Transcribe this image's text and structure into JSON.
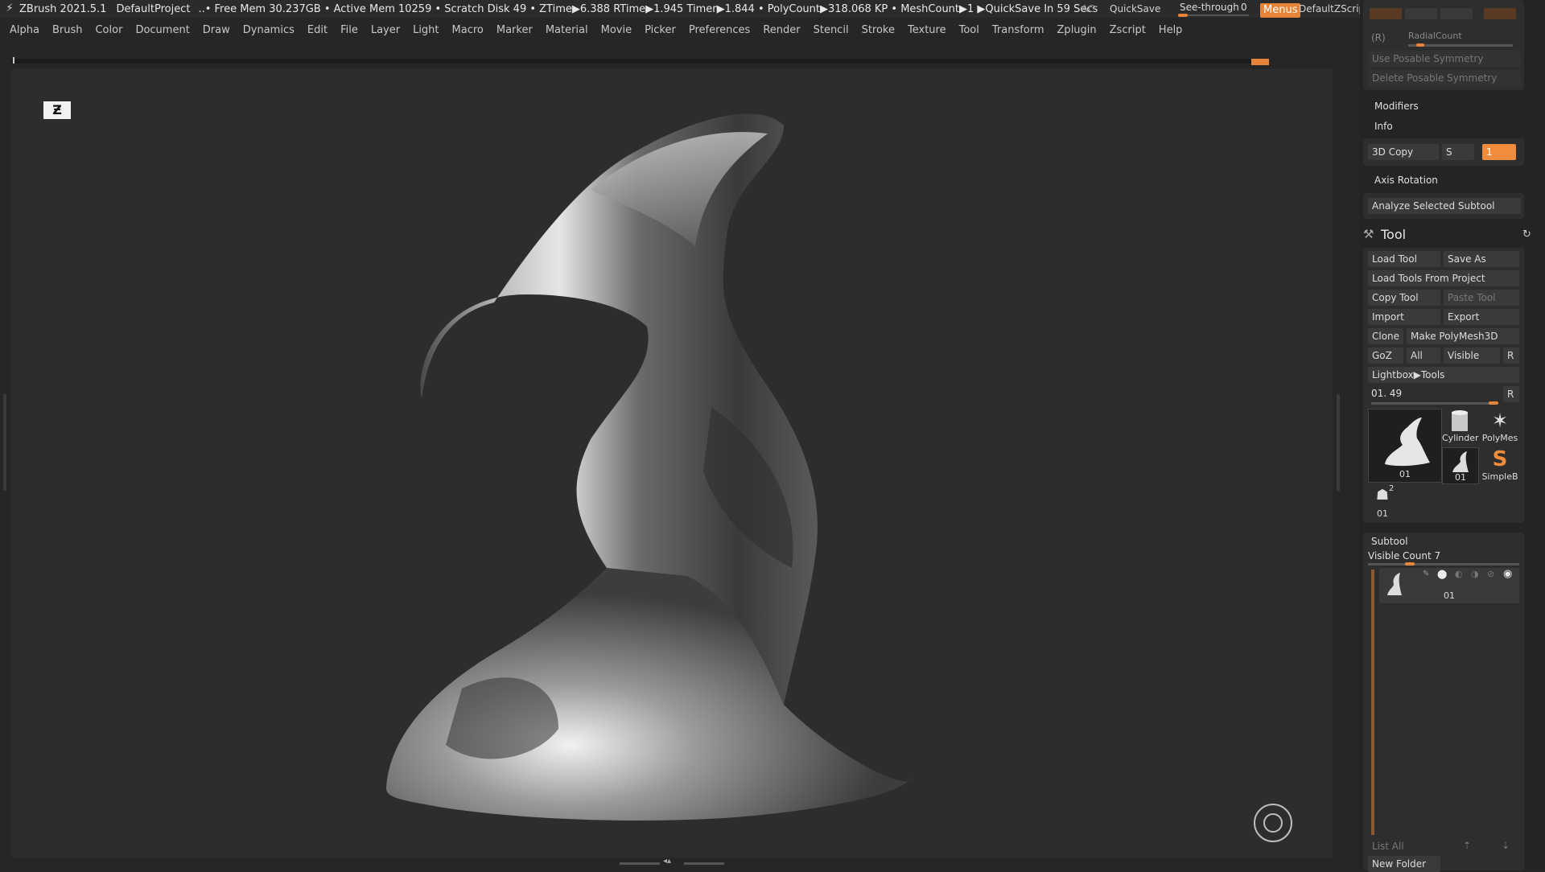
{
  "titlebar": {
    "app_name": "ZBrush 2021.5.1",
    "project": "DefaultProject",
    "stats": "..• Free Mem 30.237GB • Active Mem 10259 • Scratch Disk 49 • ZTime▶6.388 RTime▶1.945 Timer▶1.844 • PolyCount▶318.068 KP • MeshCount▶1 ▶QuickSave In 59 Secs",
    "ac": "AC",
    "quicksave": "QuickSave",
    "see_through_label": "See-through",
    "see_through_value": "0",
    "menus_label": "Menus",
    "script_label": "DefaultZScript"
  },
  "menubar": {
    "items": [
      "Alpha",
      "Brush",
      "Color",
      "Document",
      "Draw",
      "Dynamics",
      "Edit",
      "File",
      "Layer",
      "Light",
      "Macro",
      "Marker",
      "Material",
      "Movie",
      "Picker",
      "Preferences",
      "Render",
      "Stencil",
      "Stroke",
      "Texture",
      "Tool",
      "Transform",
      "Zplugin",
      "Zscript",
      "Help"
    ]
  },
  "palette": {
    "symmetry": {
      "radial_prefix": "(R)",
      "radial_count": "RadialCount",
      "use_posable": "Use Posable Symmetry",
      "delete_posable": "Delete Posable Symmetry"
    },
    "modifiers": "Modifiers",
    "info": "Info",
    "copy_3d": "3D Copy",
    "copy_s": "S",
    "copy_value": "1",
    "axis_rotation": "Axis Rotation",
    "analyze_subtool": "Analyze Selected Subtool",
    "tool": {
      "title": "Tool",
      "load_tool": "Load Tool",
      "save_as": "Save As",
      "load_from_project": "Load Tools From Project",
      "copy_tool": "Copy Tool",
      "paste_tool": "Paste Tool",
      "import": "Import",
      "export": "Export",
      "clone": "Clone",
      "make_polymesh": "Make PolyMesh3D",
      "goz": "GoZ",
      "all": "All",
      "visible": "Visible",
      "r": "R",
      "lightbox_tools": "Lightbox▶Tools",
      "current_tool": "01. 49",
      "r2": "R",
      "thumbs": [
        {
          "caption": "01"
        },
        {
          "caption": "Cylinder"
        },
        {
          "caption": "PolyMes"
        },
        {
          "caption": "01"
        },
        {
          "caption": "SimpleB"
        },
        {
          "caption": "01",
          "badge": "2"
        }
      ]
    },
    "subtool": {
      "title": "Subtool",
      "visible_count": "Visible Count 7",
      "row_name": "01",
      "list_all": "List All",
      "new_folder": "New Folder"
    }
  },
  "colors": {
    "accent": "#e8843a",
    "background": "#262626",
    "viewport": "#2d2d2d"
  }
}
